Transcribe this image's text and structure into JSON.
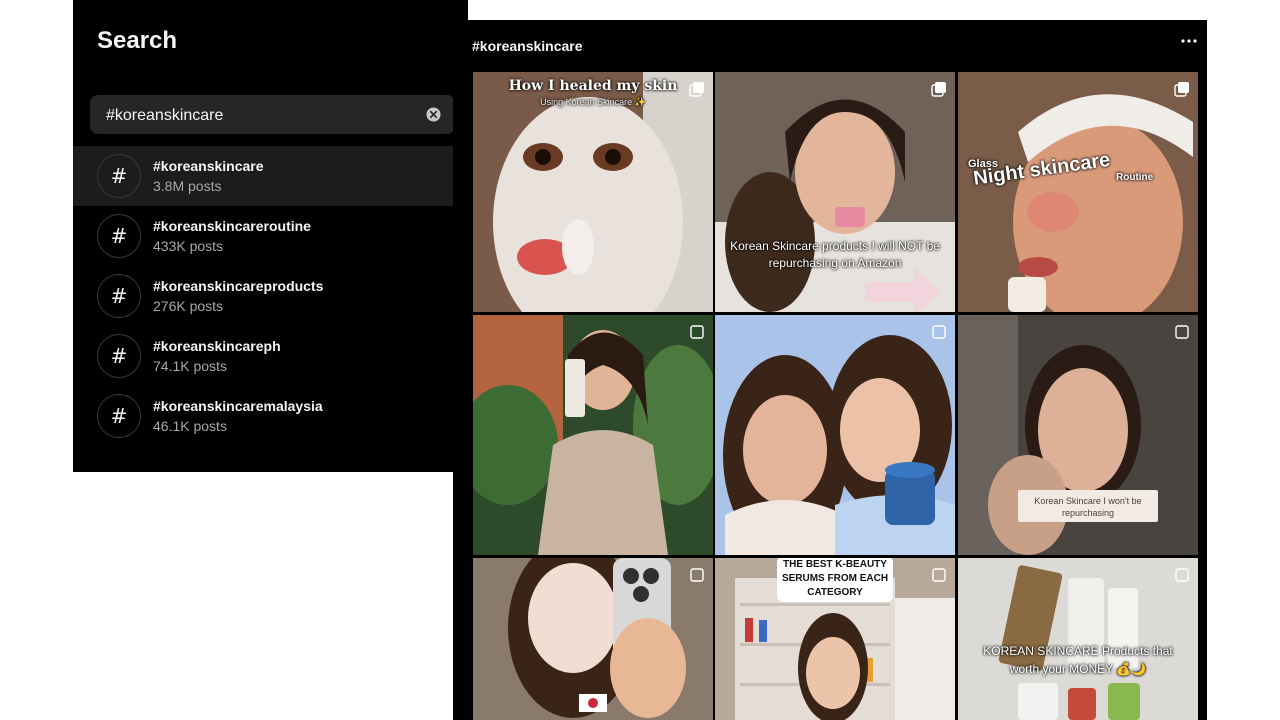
{
  "search": {
    "title": "Search",
    "query": "#koreanskincare",
    "results": [
      {
        "name": "#koreanskincare",
        "count": "3.8M posts"
      },
      {
        "name": "#koreanskincareroutine",
        "count": "433K posts"
      },
      {
        "name": "#koreanskincareproducts",
        "count": "276K posts"
      },
      {
        "name": "#koreanskincareph",
        "count": "74.1K posts"
      },
      {
        "name": "#koreanskincaremalaysia",
        "count": "46.1K posts"
      }
    ],
    "hash_symbol": "#"
  },
  "feed": {
    "title": "#koreanskincare",
    "more_icon": "more-horizontal-icon",
    "posts": [
      {
        "caption": "How I healed my skin",
        "subcaption": "Using Korean Skincare ✨"
      },
      {
        "caption": "Korean Skincare products I will NOT be repurchasing on Amazon"
      },
      {
        "caption_small": "Glass",
        "caption": "Night skincare",
        "caption_sub": "Routine"
      },
      {
        "caption": ""
      },
      {
        "caption": ""
      },
      {
        "caption": "Korean Skincare I won't be repurchasing"
      },
      {
        "caption": ""
      },
      {
        "caption": "THE BEST K-BEAUTY SERUMS FROM EACH CATEGORY"
      },
      {
        "caption": "KOREAN SKINCARE Products that worth your MONEY 💰🌙"
      }
    ]
  },
  "colors": {
    "panel_bg": "#000000",
    "input_bg": "#262626",
    "active_row": "#1c1c1c",
    "text": "#f5f5f5",
    "muted": "#a8a8a8"
  }
}
